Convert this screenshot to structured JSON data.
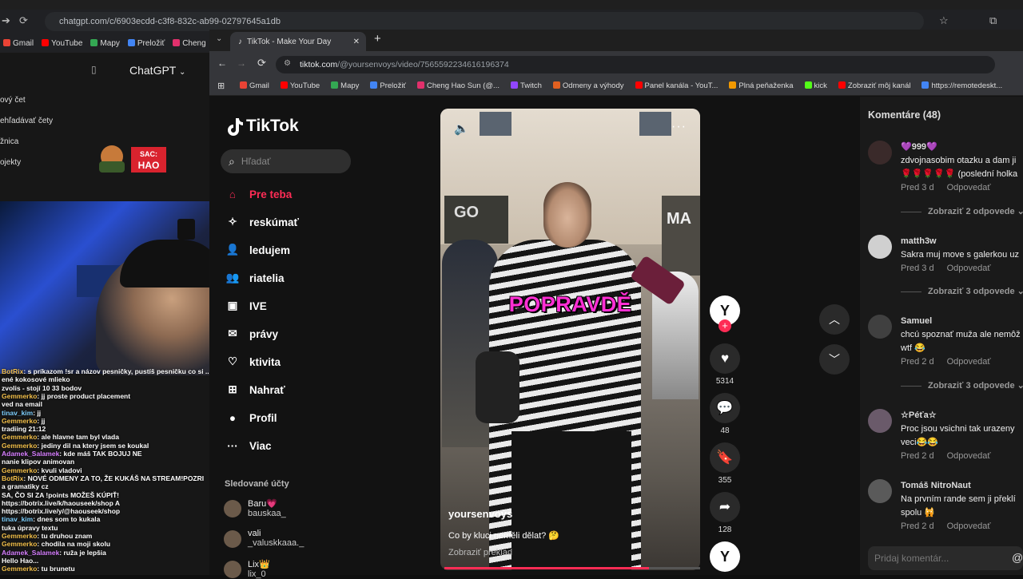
{
  "outer": {
    "url": "chatgpt.com/c/6903ecdd-c3f8-832c-ab99-02797645a1db",
    "bookmarks": [
      "Gmail",
      "YouTube",
      "Mapy",
      "Preložiť",
      "Cheng"
    ]
  },
  "chatgpt": {
    "title": "ChatGPT",
    "items": [
      "ový čet",
      "ehľadávať čety",
      "žnica",
      "ojekty"
    ],
    "badge_line1": "SAC:",
    "badge_line2": "HAO"
  },
  "chat_log": [
    {
      "name": "BotRix",
      "msg": ": s príkazom !sr a názov pesničky, pustíš pesničku co si ..."
    },
    {
      "name": "",
      "msg": "ené kokosové mlieko"
    },
    {
      "name": "",
      "msg": "zvolis - stojí 10 33 bodov"
    },
    {
      "name": "Gemmerko",
      "msg": ": jj proste product placement"
    },
    {
      "name": "",
      "msg": "ved na email"
    },
    {
      "name": "tinav_kim",
      "msg": ": jj"
    },
    {
      "name": "Gemmerko",
      "msg": ": jj"
    },
    {
      "name": "",
      "msg": "tradiing 21:12"
    },
    {
      "name": "Gemmerko",
      "msg": ": ale hlavne tam byl vlada"
    },
    {
      "name": "Gemmerko",
      "msg": ": jediny dil na ktery jsem se koukal"
    },
    {
      "name": "Adamek_Salamek",
      "msg": ": kde máš TAK BOJUJ NE"
    },
    {
      "name": "",
      "msg": "nanie klipov animovan"
    },
    {
      "name": "Gemmerko",
      "msg": ": kvuli vladovi"
    },
    {
      "name": "BotRix",
      "msg": ": NOVÉ ODMENY ZA TO, ŽE KUKÁŠ NA STREAM!POZRI"
    },
    {
      "name": "",
      "msg": "a gramatiky cz"
    },
    {
      "name": "",
      "msg": "SA, ČO SI ZA !points MOŽEŠ KÚPIŤ!"
    },
    {
      "name": "",
      "msg": "https://botrix.live/k/haouseek/shop A"
    },
    {
      "name": "",
      "msg": "https://botrix.live/y/@haouseek/shop"
    },
    {
      "name": "tinav_kim",
      "msg": ": dnes som to kukala"
    },
    {
      "name": "",
      "msg": "tuka úpravy textu"
    },
    {
      "name": "Gemmerko",
      "msg": ": tu druhou znam"
    },
    {
      "name": "Gemmerko",
      "msg": ": chodila na moji skolu"
    },
    {
      "name": "Adamek_Salamek",
      "msg": ": ruža je lepšia"
    },
    {
      "name": "",
      "msg": "Hello Hao..."
    },
    {
      "name": "Gemmerko",
      "msg": ": tu brunetu"
    }
  ],
  "inner": {
    "tab_title": "TikTok - Make Your Day",
    "url_host": "tiktok.com",
    "url_path": "/@yoursenvoys/video/7565592234616196374",
    "bookmarks": [
      "Gmail",
      "YouTube",
      "Mapy",
      "Preložiť",
      "Cheng Hao Sun (@...",
      "Twitch",
      "Odmeny a výhody",
      "Panel kanála - YouT...",
      "Plná peňaženka",
      "kick",
      "Zobraziť môj kanál",
      "https://remotedeskt..."
    ]
  },
  "tiktok": {
    "logo": "TikTok",
    "search_placeholder": "Hľadať",
    "nav": [
      {
        "label": "Pre teba",
        "icon": "home-icon"
      },
      {
        "label": "reskúmať",
        "icon": "compass-icon"
      },
      {
        "label": "ledujem",
        "icon": "following-icon"
      },
      {
        "label": "riatelia",
        "icon": "friends-icon"
      },
      {
        "label": "IVE",
        "icon": "live-icon"
      },
      {
        "label": "právy",
        "icon": "messages-icon"
      },
      {
        "label": "ktivita",
        "icon": "activity-icon"
      },
      {
        "label": "Nahrať",
        "icon": "upload-icon"
      },
      {
        "label": "Profil",
        "icon": "profile-icon"
      },
      {
        "label": "Viac",
        "icon": "more-icon"
      }
    ],
    "following_title": "Sledované účty",
    "following": [
      {
        "name": "Baru💗",
        "handle": "bauskaa_"
      },
      {
        "name": "vali",
        "handle": "_valuskkaaa._"
      },
      {
        "name": "Lix👑",
        "handle": "lix_0"
      }
    ]
  },
  "video": {
    "caption": "POPRAVDĚ",
    "shop_left": "GO",
    "shop_right": "MA",
    "username": "yoursenvoys",
    "description": "Co by kluci neměli dělat? 🤔",
    "translate": "Zobraziť preklad",
    "progress": 0.8,
    "avatar_letter": "Y",
    "likes": "5314",
    "comments": "48",
    "saves": "355",
    "shares": "128"
  },
  "comments": {
    "title": "Komentáre (48)",
    "reply_label": "Odpovedať",
    "items": [
      {
        "user": "💜999💜",
        "text": "zdvojnasobim otazku a dam ji",
        "text2": "🌹🌹🌹🌹🌹 (poslední holka",
        "time": "Pred 3 d",
        "replies": "Zobraziť 2 odpovede"
      },
      {
        "user": "matth3w",
        "text": "Sakra muj move s galerkou uz",
        "text2": "",
        "time": "Pred 3 d",
        "replies": "Zobraziť 3 odpovede"
      },
      {
        "user": "Samuel",
        "text": "chcú spoznať muža ale nemôž",
        "text2": "wtf 😂",
        "time": "Pred 2 d",
        "replies": "Zobraziť 3 odpovede"
      },
      {
        "user": "☆Péťa☆",
        "text": "Proc jsou vsichni tak urazeny",
        "text2": "veci😂😂",
        "time": "Pred 2 d",
        "replies": ""
      },
      {
        "user": "Tomáš NitroNaut",
        "text": "Na prvním rande sem ji překlí",
        "text2": "spolu 🙀",
        "time": "Pred 2 d",
        "replies": ""
      }
    ],
    "input_placeholder": "Pridaj komentár..."
  }
}
